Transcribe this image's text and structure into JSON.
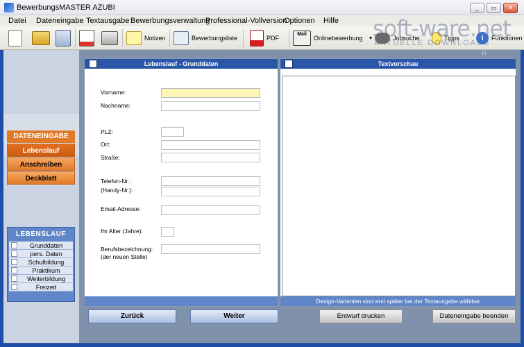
{
  "window": {
    "title": "BewerbungsMASTER AZUBI"
  },
  "menu": [
    "Datei",
    "Dateneingabe",
    "Textausgabe",
    "Bewerbungsverwaltung",
    "Professional-Vollversion",
    "Optionen",
    "Hilfe"
  ],
  "toolbar": {
    "notizen": "Notizen",
    "bewerbungsliste": "Bewerbungsliste",
    "pdf": "PDF",
    "onlinebewerbung": "Onlinebewerbung",
    "jobsuche": "Jobsuche",
    "tipps": "Tipps",
    "funktionen": "Funktionen",
    "mail_badge": "Mail"
  },
  "watermark": {
    "brand": "soft-ware.net",
    "tagline": "AKTUELLE DOWNLOADS"
  },
  "right_strip": "Fr",
  "dateneingabe": {
    "header": "DATENEINGABE",
    "items": [
      "Lebenslauf",
      "Anschreiben",
      "Deckblatt"
    ]
  },
  "lebenslauf_nav": {
    "header": "LEBENSLAUF",
    "items": [
      "Grunddaten",
      "pers. Daten",
      "Schulbildung",
      "Praktikum",
      "Weiterbildung",
      "Freizeit"
    ]
  },
  "form": {
    "header": "Lebenslauf - Grunddaten",
    "labels": {
      "vorname": "Vorname:",
      "nachname": "Nachname:",
      "plz": "PLZ:",
      "ort": "Ort:",
      "strasse": "Straße:",
      "telefon": "Telefon-Nr.:",
      "handy": "(Handy-Nr.):",
      "email": "Email-Adresse:",
      "alter": "Ihr Alter (Jahre):",
      "beruf1": "Berufsbezeichnung:",
      "beruf2": "(der neuen Stelle)"
    },
    "values": {
      "vorname": "",
      "nachname": "",
      "plz": "",
      "ort": "",
      "strasse": "",
      "telefon": "",
      "handy": "",
      "email": "",
      "alter": "",
      "beruf": ""
    }
  },
  "preview": {
    "header": "Textvorschau",
    "footer": "Design-Varianten sind erst später bei der Textausgabe wählbar"
  },
  "buttons": {
    "zurueck": "Zurück",
    "weiter": "Weiter",
    "entwurf": "Entwurf drucken",
    "beenden": "Dateneingabe beenden"
  }
}
